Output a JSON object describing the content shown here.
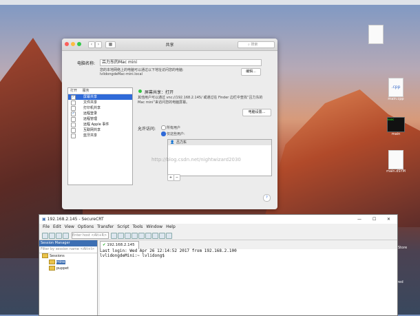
{
  "desktop": {
    "icons": [
      {
        "label": "",
        "ext": ""
      },
      {
        "label": "main.cpp",
        "ext": ".cpp"
      },
      {
        "label": "main",
        "ext": "exec"
      },
      {
        "label": "main.dSYM",
        "ext": ""
      }
    ],
    "right_edge": {
      "label_store": "Store",
      "label_lized": "lized"
    }
  },
  "sharing": {
    "title": "共享",
    "search_placeholder": "搜索",
    "computer_name_label": "电脑名称:",
    "computer_name_value": "吕力东的Mac mini",
    "local_desc": "您的本地网络上的电脑可以通过以下地址访问您的电脑:",
    "local_host": "lvlidongdeMac-mini.local",
    "edit_button": "编辑...",
    "list_header_on": "打开",
    "list_header_service": "服务",
    "services": [
      {
        "name": "屏幕共享",
        "checked": true,
        "selected": true
      },
      {
        "name": "文件共享",
        "checked": false,
        "selected": false
      },
      {
        "name": "打印机共享",
        "checked": false,
        "selected": false
      },
      {
        "name": "远程登录",
        "checked": true,
        "selected": false
      },
      {
        "name": "远程管理",
        "checked": false,
        "selected": false
      },
      {
        "name": "远程 Apple 事件",
        "checked": false,
        "selected": false
      },
      {
        "name": "互联网共享",
        "checked": false,
        "selected": false
      },
      {
        "name": "蓝牙共享",
        "checked": false,
        "selected": false
      }
    ],
    "status": "屏幕共享：打开",
    "status_desc": "其他用户可以通过 vnc://192.168.2.145/ 或通过在 Finder 边栏中查找“吕力东的Mac mini”来访问您的电脑屏幕。",
    "computer_settings_button": "电脑设置...",
    "allow_access_label": "允许访问:",
    "radio_all": "所有用户",
    "radio_only": "仅这些用户:",
    "users": [
      "吕力东"
    ],
    "watermark": "http://blog.csdn.net/nightwizard2030",
    "add_btn": "+",
    "remove_btn": "−",
    "help_btn": "?"
  },
  "crt": {
    "title": "192.168.2.145 - SecureCRT",
    "menu": [
      "File",
      "Edit",
      "View",
      "Options",
      "Transfer",
      "Script",
      "Tools",
      "Window",
      "Help"
    ],
    "host_placeholder": "Enter host <Alt+R>",
    "session_manager": "Session Manager",
    "filter_placeholder": "Filter by session name <Alt+I>",
    "tree": {
      "root": "Sessions",
      "children": [
        "mine",
        "puppet"
      ]
    },
    "tab": "192.168.2.145",
    "terminal": [
      "Last login: Wed Apr 26 12:14:52 2017 from 192.168.2.100",
      "lvlidongdeMini:~ lvlidong$"
    ]
  }
}
